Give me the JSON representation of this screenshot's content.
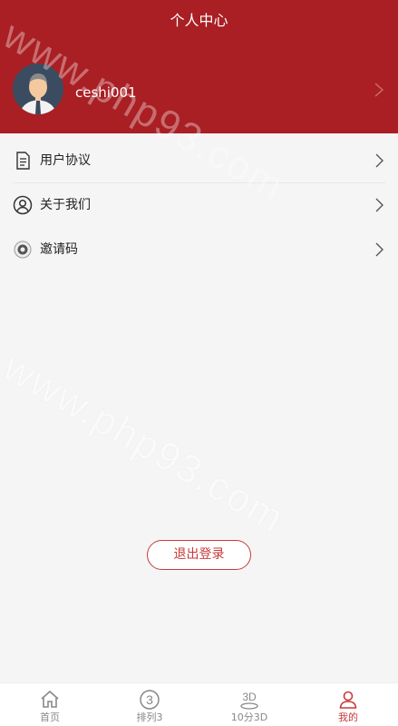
{
  "header": {
    "title": "个人中心",
    "username": "ceshi001"
  },
  "menu": {
    "items": [
      {
        "label": "用户协议",
        "icon": "document-icon"
      },
      {
        "label": "关于我们",
        "icon": "user-circle-icon"
      },
      {
        "label": "邀请码",
        "icon": "invite-code-icon"
      }
    ]
  },
  "logout_label": "退出登录",
  "tabbar": {
    "tabs": [
      {
        "label": "首页",
        "icon": "home-icon"
      },
      {
        "label": "排列3",
        "icon": "circle-3-icon"
      },
      {
        "label": "10分3D",
        "icon": "3d-icon"
      },
      {
        "label": "我的",
        "icon": "person-icon"
      }
    ],
    "active_index": 3
  },
  "watermark": "www.php93.com",
  "colors": {
    "brand": "#a91f24",
    "accent": "#c9393b",
    "background": "#f5f5f5"
  }
}
